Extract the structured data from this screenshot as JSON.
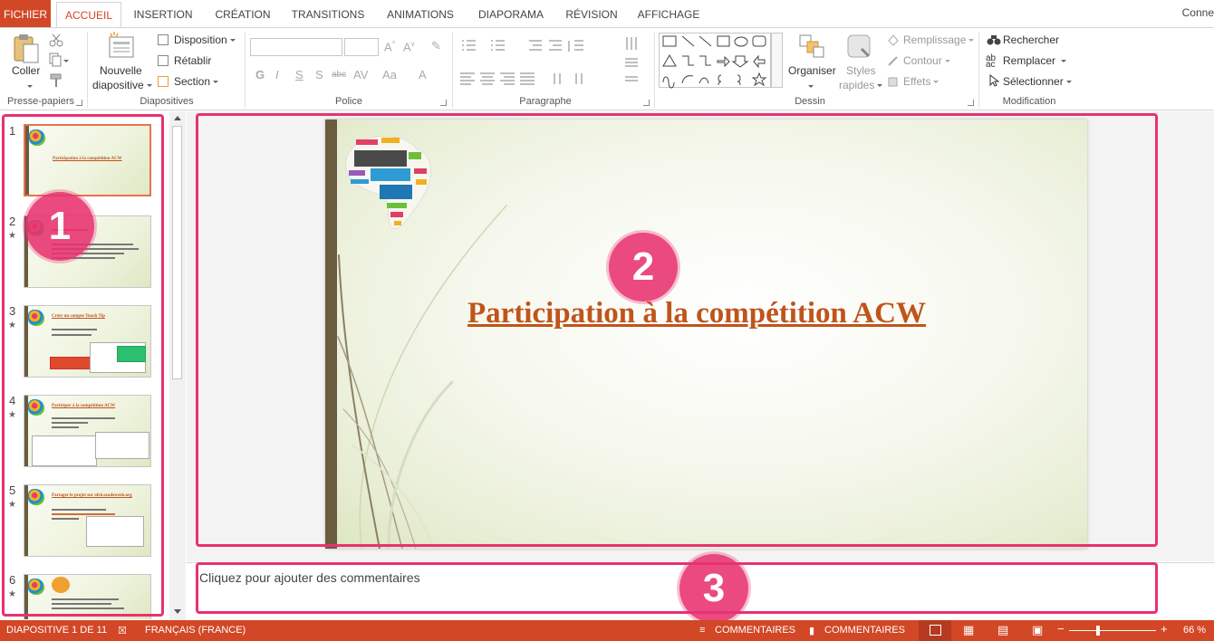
{
  "tabs": {
    "file": "FICHIER",
    "home": "ACCUEIL",
    "insert": "INSERTION",
    "design": "CRÉATION",
    "transitions": "TRANSITIONS",
    "animations": "ANIMATIONS",
    "slideshow": "DIAPORAMA",
    "review": "RÉVISION",
    "view": "AFFICHAGE",
    "account": "Conne"
  },
  "ribbon": {
    "clipboard": {
      "paste": "Coller",
      "label": "Presse-papiers"
    },
    "slides": {
      "new_slide_1": "Nouvelle",
      "new_slide_2": "diapositive",
      "layout": "Disposition",
      "reset": "Rétablir",
      "section": "Section",
      "label": "Diapositives"
    },
    "font": {
      "label": "Police"
    },
    "paragraph": {
      "label": "Paragraphe"
    },
    "drawing": {
      "arrange": "Organiser",
      "quick_styles_1": "Styles",
      "quick_styles_2": "rapides",
      "fill": "Remplissage",
      "outline": "Contour",
      "effects": "Effets",
      "label": "Dessin"
    },
    "editing": {
      "find": "Rechercher",
      "replace": "Remplacer",
      "select": "Sélectionner",
      "label": "Modification"
    }
  },
  "thumbnails": [
    {
      "number": "1",
      "title": "Participation à la compétition ACW",
      "starred": false,
      "selected": true
    },
    {
      "number": "2",
      "title": "",
      "starred": true,
      "selected": false
    },
    {
      "number": "3",
      "title": "Créer un compte Touch Tip",
      "starred": true,
      "selected": false
    },
    {
      "number": "4",
      "title": "Participer à la compétition ACW",
      "starred": true,
      "selected": false
    },
    {
      "number": "5",
      "title": "Partager le projet sur africacodeweek.org",
      "starred": true,
      "selected": false
    },
    {
      "number": "6",
      "title": "",
      "starred": true,
      "selected": false
    }
  ],
  "slide": {
    "title": "Participation à la compétition ACW"
  },
  "notes": {
    "placeholder": "Cliquez pour ajouter des commentaires"
  },
  "annotations": [
    "1",
    "2",
    "3"
  ],
  "status": {
    "slide_info": "DIAPOSITIVE 1 DE 11",
    "language": "FRANÇAIS (FRANCE)",
    "notes": "COMMENTAIRES",
    "comments": "COMMENTAIRES",
    "zoom": "66 %"
  },
  "colors": {
    "accent": "#d24726",
    "title": "#c0541b",
    "highlight": "#e8326f"
  }
}
